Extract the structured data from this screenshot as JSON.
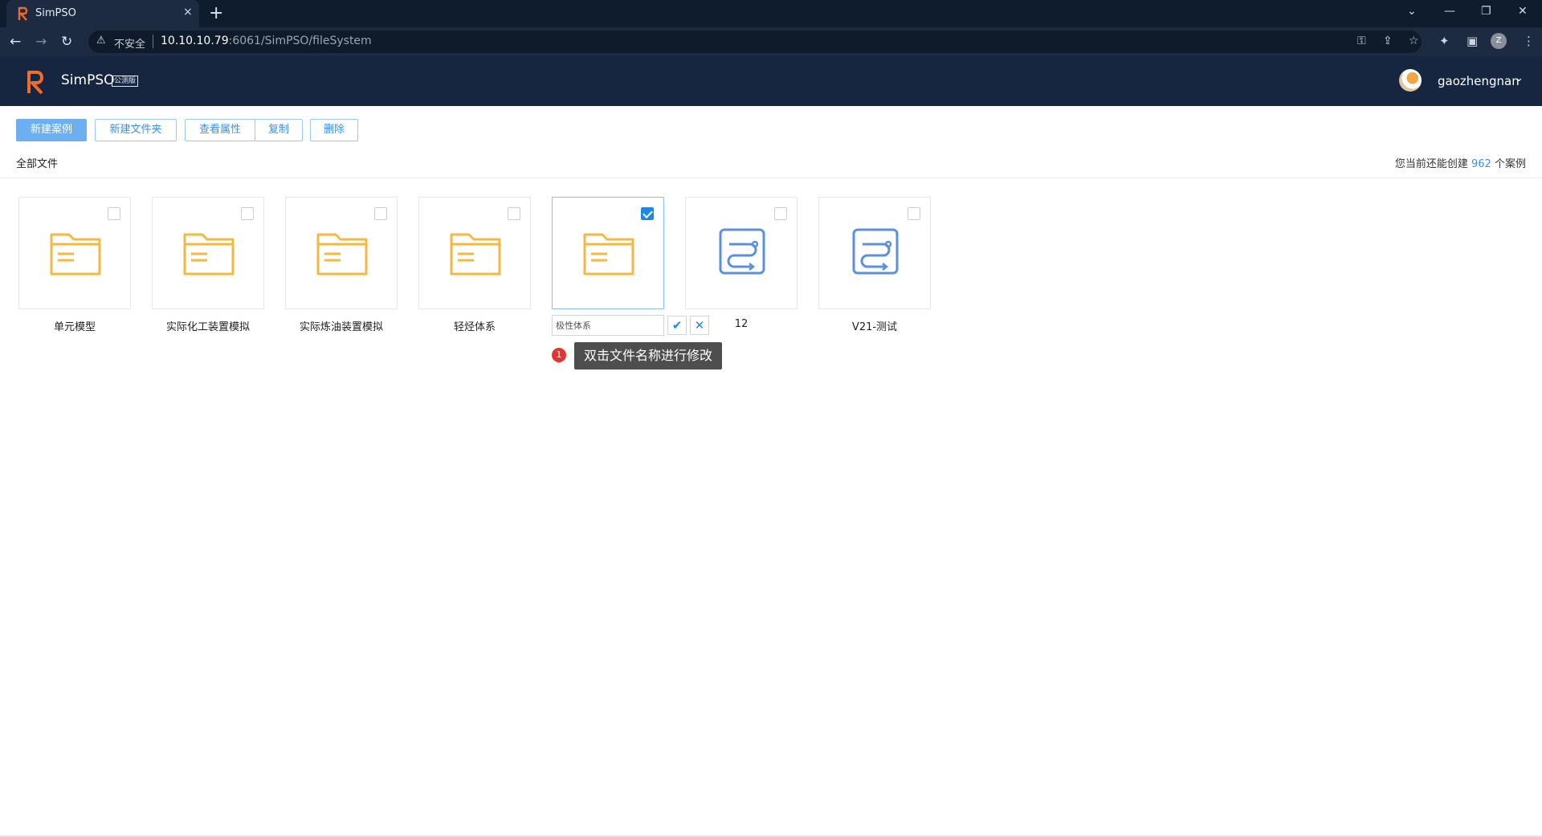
{
  "browser": {
    "tab_title": "SimPSO",
    "tab_close": "×",
    "new_tab": "+",
    "insecure_label": "不安全",
    "url_host": "10.10.10.79",
    "url_rest": ":6061/SimPSO/fileSystem",
    "profile_initial": "Z"
  },
  "app": {
    "brand": "SimPSO",
    "brand_tag": "公测版",
    "username": "gaozhengnan"
  },
  "toolbar": {
    "new_case": "新建案例",
    "new_folder": "新建文件夹",
    "view_props": "查看属性",
    "copy": "复制",
    "delete": "删除"
  },
  "breadcrumb": "全部文件",
  "quota": {
    "prefix": "您当前还能创建",
    "count": "962",
    "suffix": "个案例"
  },
  "items": [
    {
      "label": "单元模型",
      "type": "folder",
      "checked": false
    },
    {
      "label": "实际化工装置模拟",
      "type": "folder",
      "checked": false
    },
    {
      "label": "实际炼油装置模拟",
      "type": "folder",
      "checked": false
    },
    {
      "label": "轻烃体系",
      "type": "folder",
      "checked": false
    },
    {
      "label": "",
      "type": "folder",
      "checked": true
    },
    {
      "label": "12",
      "type": "case",
      "checked": false
    },
    {
      "label": "V21-测试",
      "type": "case",
      "checked": false
    }
  ],
  "rename": {
    "value": "极性体系",
    "confirm_icon": "check-icon",
    "cancel_icon": "close-icon"
  },
  "hint": {
    "badge": "1",
    "text": "双击文件名称进行修改"
  },
  "colors": {
    "header_bg": "#162640",
    "accent": "#1e88e5",
    "folder": "#f5b942",
    "case_icon": "#5b8fe0",
    "badge": "#e5342f"
  }
}
